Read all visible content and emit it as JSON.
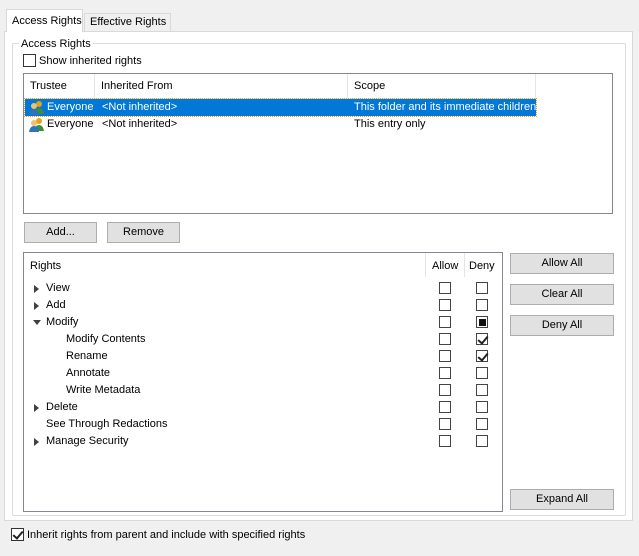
{
  "tabs": [
    {
      "label": "Access Rights",
      "active": true
    },
    {
      "label": "Effective Rights",
      "active": false
    }
  ],
  "group_title": "Access Rights",
  "show_inherited": {
    "label": "Show inherited rights",
    "checked": false
  },
  "trustee_table": {
    "columns": [
      "Trustee",
      "Inherited From",
      "Scope"
    ],
    "rows": [
      {
        "trustee": "Everyone",
        "inherited_from": "<Not inherited>",
        "scope": "This folder and its immediate children",
        "selected": true
      },
      {
        "trustee": "Everyone",
        "inherited_from": "<Not inherited>",
        "scope": "This entry only",
        "selected": false
      }
    ]
  },
  "buttons": {
    "add": "Add...",
    "remove": "Remove",
    "allow_all": "Allow All",
    "clear_all": "Clear All",
    "deny_all": "Deny All",
    "expand_all": "Expand All"
  },
  "rights_tree": {
    "header": {
      "rights": "Rights",
      "allow": "Allow",
      "deny": "Deny"
    },
    "items": [
      {
        "label": "View",
        "expander": "collapsed",
        "allow": false,
        "deny": "unchecked"
      },
      {
        "label": "Add",
        "expander": "collapsed",
        "allow": false,
        "deny": "unchecked"
      },
      {
        "label": "Modify",
        "expander": "expanded",
        "allow": false,
        "deny": "indeterminate"
      },
      {
        "label": "Modify Contents",
        "expander": "none",
        "allow": false,
        "deny": "checked"
      },
      {
        "label": "Rename",
        "expander": "none",
        "allow": false,
        "deny": "checked"
      },
      {
        "label": "Annotate",
        "expander": "none",
        "allow": false,
        "deny": "unchecked"
      },
      {
        "label": "Write Metadata",
        "expander": "none",
        "allow": false,
        "deny": "unchecked"
      },
      {
        "label": "Delete",
        "expander": "collapsed",
        "allow": false,
        "deny": "unchecked"
      },
      {
        "label": "See Through Redactions",
        "expander": "none",
        "allow": false,
        "deny": "unchecked"
      },
      {
        "label": "Manage Security",
        "expander": "collapsed",
        "allow": false,
        "deny": "unchecked"
      }
    ]
  },
  "inherit": {
    "label": "Inherit rights from parent and include with specified rights",
    "checked": true
  },
  "colors": {
    "selection": "#0078d7",
    "button_face": "#e1e1e1"
  }
}
